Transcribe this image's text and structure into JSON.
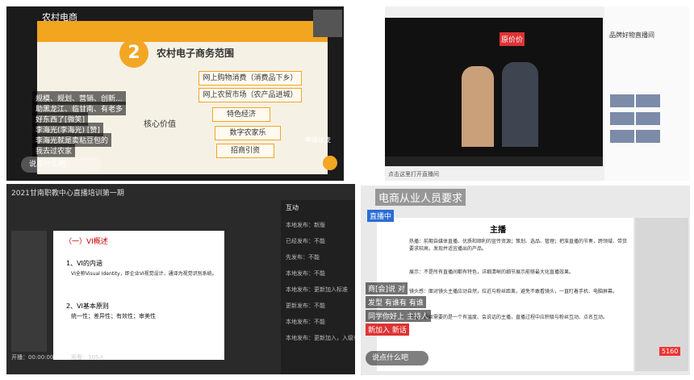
{
  "p1": {
    "header": "农村电商",
    "slide_title": "农村电子商务范围",
    "slide_number": "2",
    "left_box": "核心价值",
    "items": [
      "网上购物消费（消费品下乡）",
      "网上农贸市场（农产品进城）",
      "特色经济",
      "数字农家乐",
      "招商引资"
    ],
    "chat": [
      "规模、规划、营销、创新...",
      "助黑龙江、临甘南、有老多",
      "好东西了[微笑]",
      "李海光(李海光) [赞]",
      "李海光就是卖粘豆包的",
      "我去过农家"
    ],
    "comment_placeholder": "说点什么吧",
    "badge": "申请连麦"
  },
  "p2": {
    "sidebar_title": "品牌好物直播间",
    "overlay_text": "原价价",
    "bottom_text": "点击这里打开直播间"
  },
  "p3": {
    "window_title": "2021甘南职教中心直播培训第一期",
    "slide_header": "（一）VI概述",
    "s1_title": "1、VI的内涵",
    "s1_body": "VI全称Visual Identity，即企业VI视觉设计，通译为视觉识别系统。",
    "s2_title": "2、VI基本原则",
    "s2_body": "统一性；差异性；有效性；审美性",
    "panel_title": "互动",
    "rows": [
      "本地发布：新版",
      "已经发布：不能",
      "先发布：不能",
      "本地发布：不能",
      "本地发布：更新加入标准",
      "更新发布：不能",
      "本地发布：不能",
      "本地发布：更新加入，入级有"
    ],
    "status": "开播：00:00:00",
    "viewers": "观看：105人"
  },
  "p4": {
    "header": "电商从业人员要求",
    "slide_title": "主播",
    "para1": "热播：前期自媒体直播、优质和顺利的宣传资源；策划、选品、管理；把准直播的节奏，跨领域、带货要求较高，发现并适宜播出的产品。",
    "para2": "展示：不是所有直播间都有特色，详细清晰的细节展示能够最大化直播效果。",
    "para3": "镜头感：面对镜头主播应动自然，拉近与粉丝距离，避免不敢看镜头，一直盯着手机、电脑屏幕。",
    "para4": "互动：粉丝需要的是一个有温度、会说话的主播，直播过程中应积极与粉丝互动、点名互动。",
    "tags": [
      "直播中",
      "商[会]说 对",
      "发型 有谁有 有谁",
      "同学你好上 主持人",
      "新加入 新话"
    ],
    "comment_placeholder": "说点什么吧",
    "like_count": "5160"
  }
}
